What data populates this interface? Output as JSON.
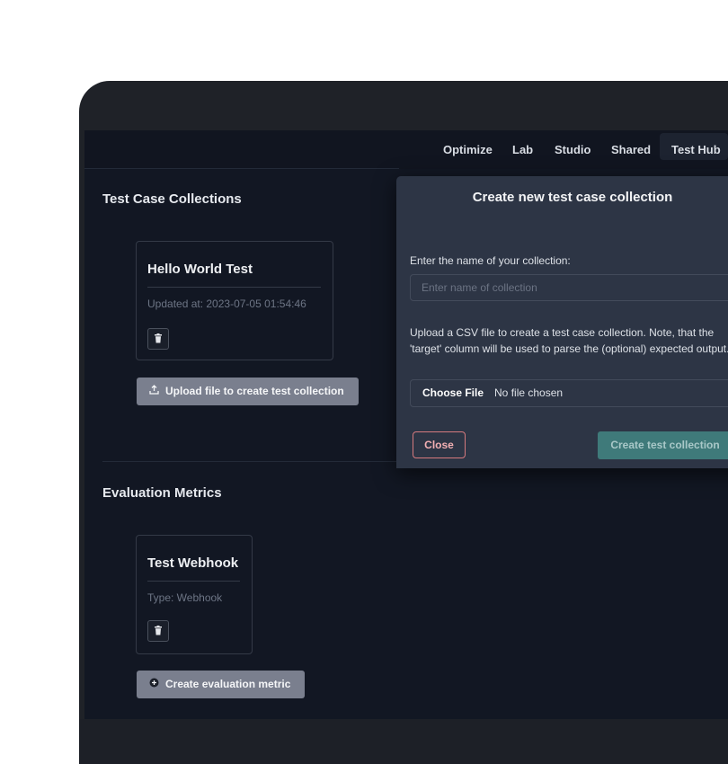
{
  "nav": {
    "items": [
      "Optimize",
      "Lab",
      "Studio",
      "Shared",
      "Test Hub"
    ],
    "active": "Test Hub"
  },
  "collections": {
    "title": "Test Case Collections",
    "card": {
      "title": "Hello World Test",
      "updated": "Updated at: 2023-07-05 01:54:46",
      "delete_icon": "trash-icon"
    },
    "upload_button": {
      "icon": "upload-icon",
      "label": "Upload file to create test collection"
    }
  },
  "metrics": {
    "title": "Evaluation Metrics",
    "card": {
      "title": "Test Webhook",
      "type": "Type: Webhook",
      "delete_icon": "trash-icon"
    },
    "create_button": {
      "icon": "plus-circle-icon",
      "label": "Create evaluation metric"
    }
  },
  "modal": {
    "title": "Create new test case collection",
    "close_icon": "x-icon",
    "name_label": "Enter the name of your collection:",
    "name_placeholder": "Enter name of collection",
    "upload_help": "Upload a CSV file to create a test case collection. Note, that the 'target' column will be used to parse the (optional) expected output.",
    "file_button": "Choose File",
    "file_status": "No file chosen",
    "close_button": "Close",
    "create_button": "Create test collection"
  },
  "colors": {
    "background": "#121723",
    "modal": "#2d3545",
    "accent_teal": "#3f7a7a",
    "close_red": "#d67a7e"
  }
}
